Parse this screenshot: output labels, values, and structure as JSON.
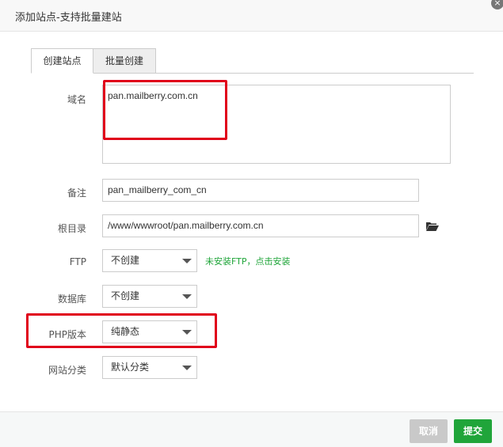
{
  "dialog": {
    "title": "添加站点-支持批量建站",
    "close_glyph": "×"
  },
  "tabs": [
    {
      "label": "创建站点",
      "active": true
    },
    {
      "label": "批量创建",
      "active": false
    }
  ],
  "form": {
    "domain": {
      "label": "域名",
      "value": "pan.mailberry.com.cn"
    },
    "remark": {
      "label": "备注",
      "value": "pan_mailberry_com_cn"
    },
    "root_dir": {
      "label": "根目录",
      "value": "/www/wwwroot/pan.mailberry.com.cn"
    },
    "ftp": {
      "label": "FTP",
      "value": "不创建",
      "note": "未安装FTP，点击安装"
    },
    "database": {
      "label": "数据库",
      "value": "不创建"
    },
    "php_version": {
      "label": "PHP版本",
      "value": "纯静态"
    },
    "category": {
      "label": "网站分类",
      "value": "默认分类"
    }
  },
  "buttons": {
    "cancel": "取消",
    "submit": "提交"
  },
  "colors": {
    "accent_green": "#20a53a",
    "highlight_red": "#e0001a"
  },
  "icons": {
    "folder": "folder-open-icon",
    "close": "close-icon"
  }
}
